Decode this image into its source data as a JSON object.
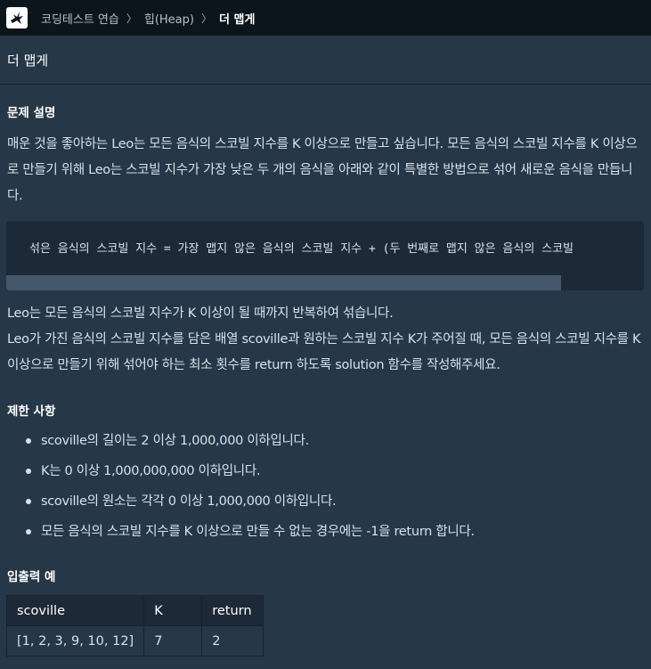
{
  "breadcrumb": {
    "items": [
      "코딩테스트 연습",
      "힙(Heap)"
    ],
    "current": "더 맵게",
    "separator": "〉"
  },
  "problem": {
    "title": "더 맵게"
  },
  "description": {
    "heading": "문제 설명",
    "intro": "매운 것을 좋아하는 Leo는 모든 음식의 스코빌 지수를 K 이상으로 만들고 싶습니다. 모든 음식의 스코빌 지수를 K 이상으로 만들기 위해 Leo는 스코빌 지수가 가장 낮은 두 개의 음식을 아래와 같이 특별한 방법으로 섞어 새로운 음식을 만듭니다.",
    "code": "섞은 음식의 스코빌 지수 = 가장 맵지 않은 음식의 스코빌 지수 + (두 번째로 맵지 않은 음식의 스코빌",
    "code_scroll_fraction": 0.87,
    "outro": "Leo는 모든 음식의 스코빌 지수가 K 이상이 될 때까지 반복하여 섞습니다.\nLeo가 가진 음식의 스코빌 지수를 담은 배열 scoville과 원하는 스코빌 지수 K가 주어질 때, 모든 음식의 스코빌 지수를 K 이상으로 만들기 위해 섞어야 하는 최소 횟수를 return 하도록 solution 함수를 작성해주세요."
  },
  "constraints": {
    "heading": "제한 사항",
    "items": [
      "scoville의 길이는 2 이상 1,000,000 이하입니다.",
      "K는 0 이상 1,000,000,000 이하입니다.",
      "scoville의 원소는 각각 0 이상 1,000,000 이하입니다.",
      "모든 음식의 스코빌 지수를 K 이상으로 만들 수 없는 경우에는 -1을 return 합니다."
    ]
  },
  "examples": {
    "heading": "입출력 예",
    "columns": [
      "scoville",
      "K",
      "return"
    ],
    "rows": [
      [
        "[1, 2, 3, 9, 10, 12]",
        "7",
        "2"
      ]
    ]
  },
  "colors": {
    "topbar": "#0c151c",
    "background": "#263747",
    "codebox": "#1d2936",
    "text": "#d7e2eb"
  },
  "icons": {
    "logo": "programmers-logo-icon"
  }
}
